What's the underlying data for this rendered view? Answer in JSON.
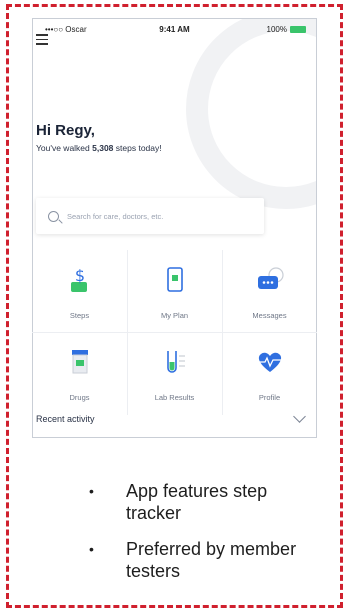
{
  "status_bar": {
    "carrier": "•••○○ Oscar",
    "time": "9:41 AM",
    "battery": "100%"
  },
  "greeting": "Hi Regy,",
  "steps_summary": {
    "prefix": "You've walked ",
    "count": "5,308",
    "suffix": " steps today!"
  },
  "search": {
    "placeholder": "Search for care, doctors, etc."
  },
  "tiles": [
    {
      "label": "Steps",
      "icon": "dollar-hand-icon"
    },
    {
      "label": "My Plan",
      "icon": "phone-card-icon"
    },
    {
      "label": "Messages",
      "icon": "chat-bubble-icon"
    },
    {
      "label": "Drugs",
      "icon": "pill-bottle-icon"
    },
    {
      "label": "Lab Results",
      "icon": "test-tube-icon"
    },
    {
      "label": "Profile",
      "icon": "heart-pulse-icon"
    }
  ],
  "recent_activity": "Recent activity",
  "bullets": [
    "App features step tracker",
    "Preferred by member testers"
  ],
  "colors": {
    "dashed_border": "#d0202e",
    "accent_blue": "#2f6fe0",
    "accent_green": "#2fb37a"
  }
}
